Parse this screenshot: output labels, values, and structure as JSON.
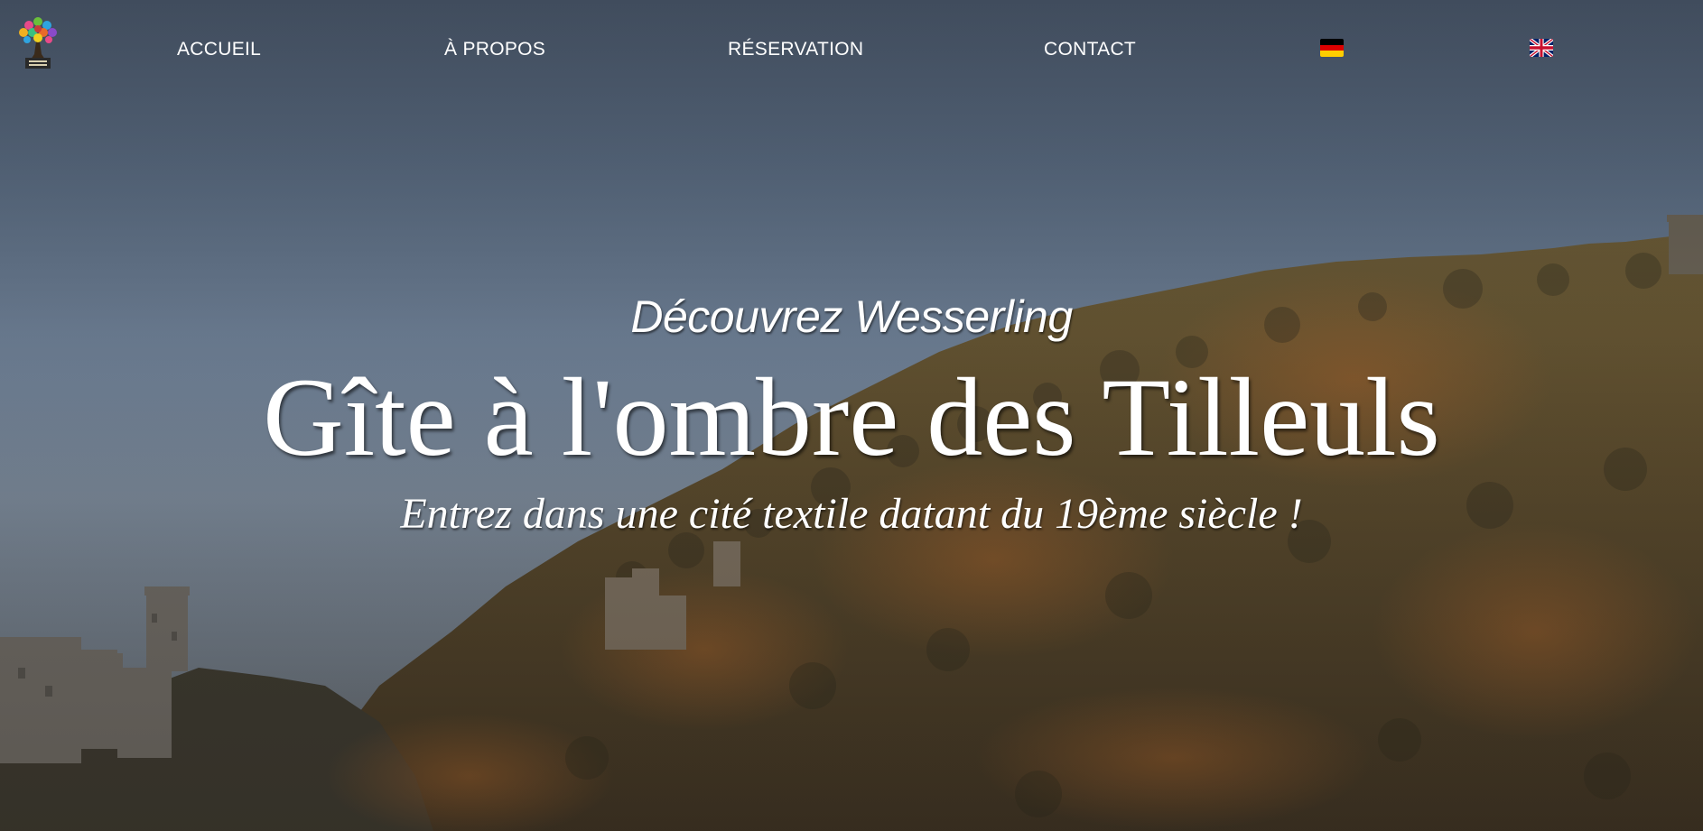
{
  "nav": {
    "logo_icon": "tree-logo-icon",
    "links": [
      {
        "label": "ACCUEIL"
      },
      {
        "label": "À PROPOS"
      },
      {
        "label": "RÉSERVATION"
      },
      {
        "label": "CONTACT"
      }
    ],
    "languages": [
      {
        "icon": "german-flag-icon",
        "colors": [
          "#000000",
          "#dd0000",
          "#ffce00"
        ]
      },
      {
        "icon": "uk-flag-icon",
        "colors": [
          "#012169",
          "#ffffff",
          "#c8102e"
        ]
      }
    ]
  },
  "hero": {
    "background": "castle-ruins-forest-hillside-photo",
    "tagline": "Découvrez Wesserling",
    "title": "Gîte à l'ombre des Tilleuls",
    "subtitle": "Entrez dans une cité textile datant du 19ème siècle !"
  }
}
